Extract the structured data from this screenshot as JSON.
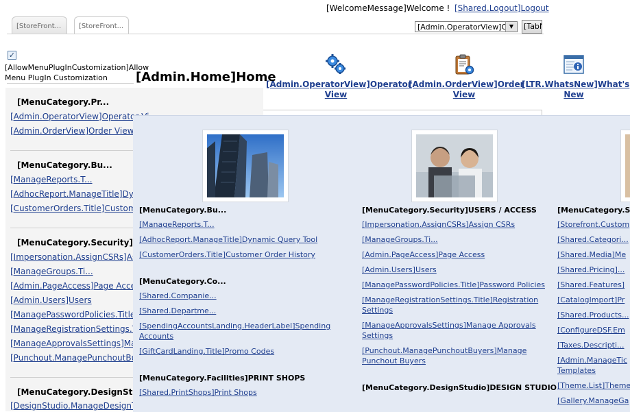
{
  "header": {
    "welcome": "[WelcomeMessage]Welcome !",
    "logout": "[Shared.Logout]Logout",
    "tabs": [
      "[StoreFront...",
      "[StoreFront..."
    ],
    "select_value": "[Admin.OperatorView]Ope",
    "tab_button": "[TabN"
  },
  "customization": {
    "checkbox_checked": true,
    "label": "[AllowMenuPlugInCustomization]Allow Menu PlugIn Customization"
  },
  "page_title": "[Admin.Home]Home",
  "actions": [
    {
      "icon": "gears-icon",
      "line1": "[Admin.OperatorView]Operator",
      "line2": "View"
    },
    {
      "icon": "clipboard-gear-icon",
      "line1": "[Admin.OrderView]Order",
      "line2": "View"
    },
    {
      "icon": "info-window-icon",
      "line1": "[LTR.WhatsNew]What's",
      "line2": "New"
    }
  ],
  "left_menu": {
    "cat1": "[MenuCategory.Pr...",
    "cat1_items": [
      "[Admin.OperatorView]Operator Vi",
      "[Admin.OrderView]Order View"
    ],
    "cat2": "[MenuCategory.Bu...",
    "cat2_items": [
      "[ManageReports.T...",
      "[AdhocReport.ManageTitle]Dyn",
      "[CustomerOrders.Title]Custom"
    ],
    "cat3": "[MenuCategory.Security]USER",
    "cat3_items": [
      "[Impersonation.AssignCSRs]As",
      "[ManageGroups.Ti...",
      "[Admin.PageAccess]Page Acces",
      "[Admin.Users]Users",
      "[ManagePasswordPolicies.Title]",
      "[ManageRegistrationSettings.Tit",
      "[ManageApprovalsSettings]Man",
      "[Punchout.ManagePunchoutBuye"
    ],
    "cat4": "[MenuCategory.DesignStudio]",
    "cat4_items": [
      "[DesignStudio.ManageDesignTe"
    ]
  },
  "flyout": {
    "col1": {
      "head1": "[MenuCategory.Bu...",
      "items1": [
        "[ManageReports.T...",
        "[AdhocReport.ManageTitle]Dynamic Query Tool",
        "[CustomerOrders.Title]Customer Order History"
      ],
      "head2": "[MenuCategory.Co...",
      "items2": [
        "[Shared.Companie...",
        "[Shared.Departme...",
        "[SpendingAccountsLanding.HeaderLabel]Spending Accounts",
        "[GiftCardLanding.Title]Promo Codes"
      ],
      "head3": "[MenuCategory.Facilities]PRINT SHOPS",
      "items3": [
        "[Shared.PrintShops]Print Shops"
      ]
    },
    "col2": {
      "head1": "[MenuCategory.Security]USERS / ACCESS",
      "items1": [
        "[Impersonation.AssignCSRs]Assign CSRs",
        "[ManageGroups.Ti...",
        "[Admin.PageAccess]Page Access",
        "[Admin.Users]Users",
        "[ManagePasswordPolicies.Title]Password Policies",
        "[ManageRegistrationSettings.Title]Registration Settings",
        "[ManageApprovalsSettings]Manage Approvals Settings",
        "[Punchout.ManagePunchoutBuyers]Manage Punchout Buyers"
      ],
      "head2": "[MenuCategory.DesignStudio]DESIGN STUDIO"
    },
    "col3": {
      "head1": "[MenuCategory.Sit",
      "items1": [
        "[Storefront.Custom",
        "[Shared.Categori...",
        "[Shared.Media]Me",
        "[Shared.Pricing]...",
        "[Shared.Features]",
        "[CatalogImport]Pr",
        "[Shared.Products...",
        "[ConfigureDSF.Em",
        "[Taxes.Descripti...",
        "[Admin.ManageTic Templates",
        "[Theme.List]Theme",
        "[Gallery.ManageGa"
      ]
    }
  }
}
